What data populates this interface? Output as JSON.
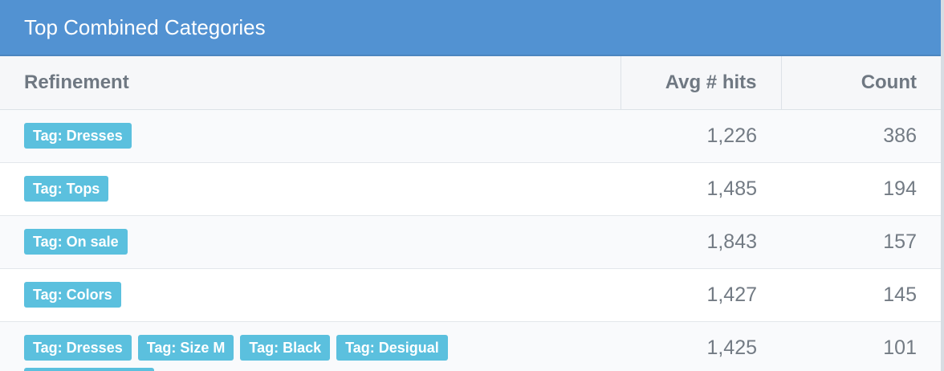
{
  "panel": {
    "title": "Top Combined Categories"
  },
  "table": {
    "headers": {
      "refinement": "Refinement",
      "avg_hits": "Avg # hits",
      "count": "Count"
    },
    "rows": [
      {
        "tags": [
          "Tag: Dresses"
        ],
        "avg_hits": "1,226",
        "count": "386"
      },
      {
        "tags": [
          "Tag: Tops"
        ],
        "avg_hits": "1,485",
        "count": "194"
      },
      {
        "tags": [
          "Tag: On sale"
        ],
        "avg_hits": "1,843",
        "count": "157"
      },
      {
        "tags": [
          "Tag: Colors"
        ],
        "avg_hits": "1,427",
        "count": "145"
      },
      {
        "tags": [
          "Tag: Dresses",
          "Tag: Size M",
          "Tag: Black",
          "Tag: Desigual"
        ],
        "avg_hits": "1,425",
        "count": "101"
      }
    ]
  },
  "colors": {
    "header_bg": "#5292d2",
    "tag_bg": "#5bc0de",
    "text_muted": "#737b84"
  }
}
